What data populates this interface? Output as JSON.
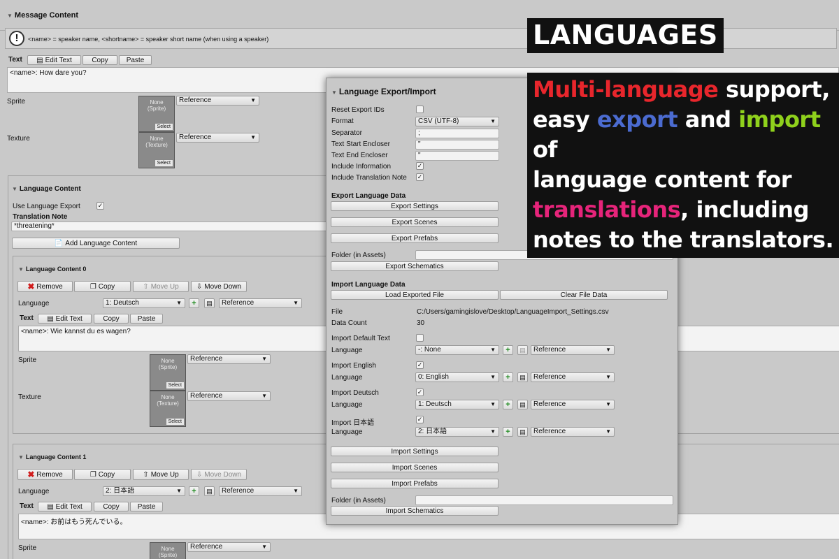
{
  "message": {
    "title": "Message Content",
    "info": "<name> = speaker name, <shortname> = speaker short name (when using a speaker)",
    "text_label": "Text",
    "edit_text": "Edit Text",
    "copy": "Copy",
    "paste": "Paste",
    "text_value": "<name>: How dare you?",
    "sprite_label": "Sprite",
    "texture_label": "Texture",
    "none_sprite": "None\n(Sprite)",
    "none_texture": "None\n(Texture)",
    "select": "Select",
    "reference": "Reference"
  },
  "language_content": {
    "title": "Language Content",
    "use_export_label": "Use Language Export",
    "use_export_checked": true,
    "translation_note_label": "Translation Note",
    "translation_note_value": "*threatening*",
    "add_button": "Add Language Content"
  },
  "lc0": {
    "title": "Language Content 0",
    "remove": "Remove",
    "copy": "Copy",
    "move_up": "Move Up",
    "move_down": "Move Down",
    "language_label": "Language",
    "language_value": "1: Deutsch",
    "reference": "Reference",
    "text_label": "Text",
    "edit_text": "Edit Text",
    "copy_text": "Copy",
    "paste": "Paste",
    "text_value": "<name>: Wie kannst du es wagen?",
    "sprite_label": "Sprite",
    "texture_label": "Texture"
  },
  "lc1": {
    "title": "Language Content 1",
    "remove": "Remove",
    "copy": "Copy",
    "move_up": "Move Up",
    "move_down": "Move Down",
    "language_label": "Language",
    "language_value": "2: 日本語",
    "reference": "Reference",
    "text_label": "Text",
    "edit_text": "Edit Text",
    "copy_text": "Copy",
    "paste": "Paste",
    "text_value": "<name>: お前はもう死んでいる。",
    "sprite_label": "Sprite"
  },
  "export_window": {
    "title": "Language Export/Import",
    "reset_ids_label": "Reset Export IDs",
    "format_label": "Format",
    "format_value": "CSV (UTF-8)",
    "separator_label": "Separator",
    "separator_value": ";",
    "start_encloser_label": "Text Start Encloser",
    "start_encloser_value": "\"",
    "end_encloser_label": "Text End Encloser",
    "end_encloser_value": "\"",
    "include_info_label": "Include Information",
    "include_note_label": "Include Translation Note",
    "export_header": "Export Language Data",
    "export_settings": "Export Settings",
    "export_scenes": "Export Scenes",
    "export_prefabs": "Export Prefabs",
    "folder_label": "Folder (in Assets)",
    "export_schematics": "Export Schematics",
    "import_header": "Import Language Data",
    "load_file": "Load Exported File",
    "clear_file": "Clear File Data",
    "file_label": "File",
    "file_value": "C:/Users/gamingislove/Desktop/LanguageImport_Settings.csv",
    "data_count_label": "Data Count",
    "data_count_value": "30",
    "import_default_label": "Import Default Text",
    "language_label": "Language",
    "lang_none": "-: None",
    "import_english_label": "Import English",
    "lang_english": "0: English",
    "import_deutsch_label": "Import Deutsch",
    "lang_deutsch": "1: Deutsch",
    "import_japanese_label": "Import 日本語",
    "lang_japanese": "2: 日本語",
    "reference": "Reference",
    "import_settings": "Import Settings",
    "import_scenes": "Import Scenes",
    "import_prefabs": "Import Prefabs",
    "import_schematics": "Import Schematics"
  },
  "overlay": {
    "title": "LANGUAGES",
    "line1_a": "Multi-language",
    "line1_b": " support,",
    "line2_a": "easy ",
    "line2_b": "export",
    "line2_c": " and ",
    "line2_d": "import",
    "line2_e": " of",
    "line3": "language content for",
    "line4_a": "translations",
    "line4_b": ", including",
    "line5": "notes to the translators."
  },
  "colors": {
    "red": "#e8262c",
    "blue": "#4b6bd0",
    "green": "#8fd11c",
    "pink": "#e6247a"
  }
}
